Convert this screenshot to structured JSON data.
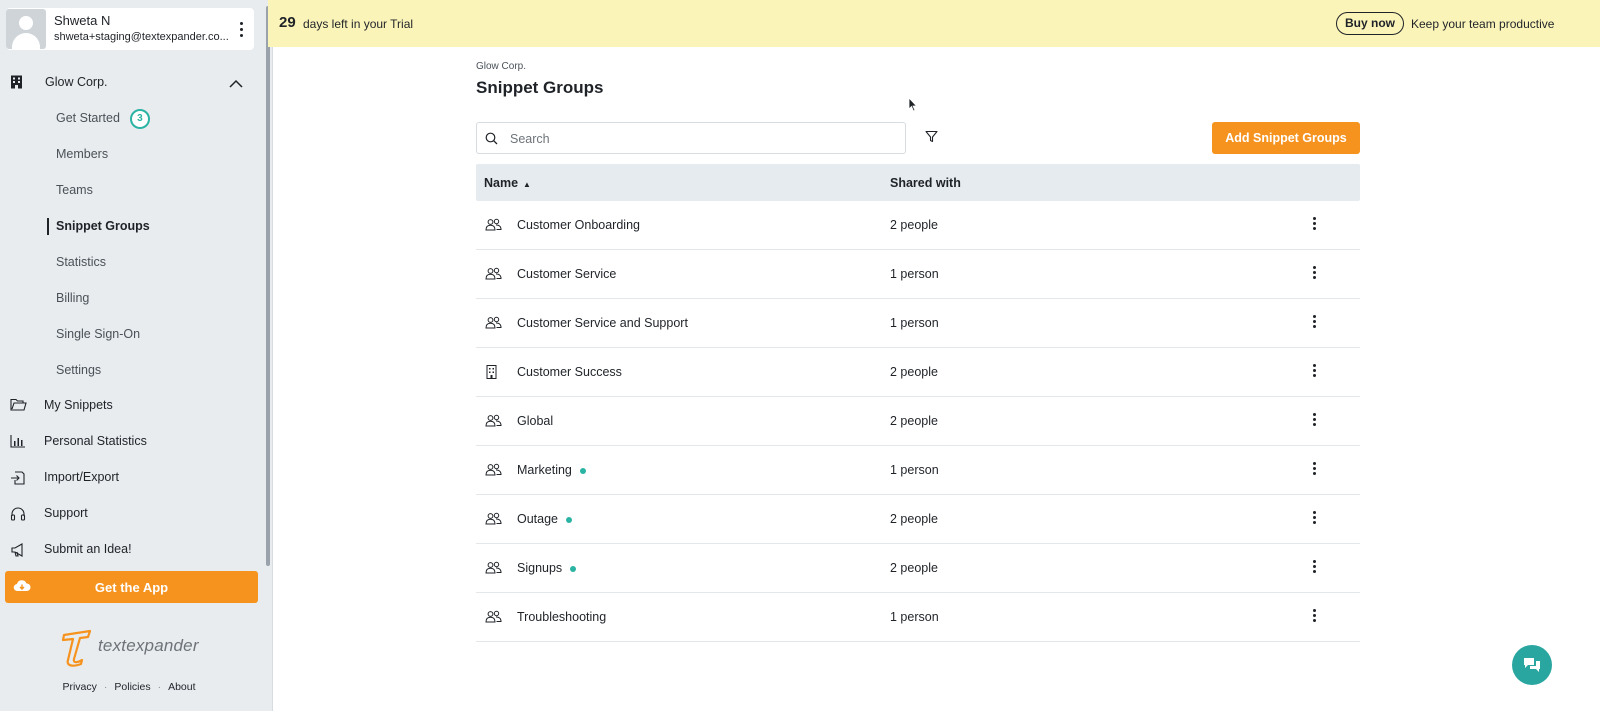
{
  "user": {
    "name": "Shweta N",
    "email": "shweta+staging@textexpander.co..."
  },
  "org": {
    "name": "Glow Corp.",
    "subnav": [
      {
        "label": "Get Started",
        "badge": "3"
      },
      {
        "label": "Members"
      },
      {
        "label": "Teams"
      },
      {
        "label": "Snippet Groups",
        "active": true
      },
      {
        "label": "Statistics"
      },
      {
        "label": "Billing"
      },
      {
        "label": "Single Sign-On"
      },
      {
        "label": "Settings"
      }
    ]
  },
  "mainnav": [
    {
      "label": "My Snippets",
      "icon": "folder-icon"
    },
    {
      "label": "Personal Statistics",
      "icon": "bar-chart-icon"
    },
    {
      "label": "Import/Export",
      "icon": "import-export-icon"
    },
    {
      "label": "Support",
      "icon": "headset-icon"
    },
    {
      "label": "Submit an Idea!",
      "icon": "megaphone-icon"
    }
  ],
  "get_app": {
    "label": "Get the App"
  },
  "logo": {
    "text": "textexpander"
  },
  "footer": {
    "privacy": "Privacy",
    "policies": "Policies",
    "about": "About"
  },
  "banner": {
    "days": "29",
    "days_text": "days left in your Trial",
    "buy_now": "Buy now",
    "tagline": "Keep your team productive"
  },
  "page": {
    "breadcrumb": "Glow Corp.",
    "title": "Snippet Groups",
    "search_placeholder": "Search",
    "add_button": "Add Snippet Groups"
  },
  "table": {
    "col_name": "Name",
    "col_shared": "Shared with",
    "rows": [
      {
        "name": "Customer Onboarding",
        "shared": "2 people",
        "icon": "people-icon",
        "dot": false
      },
      {
        "name": "Customer Service",
        "shared": "1 person",
        "icon": "people-icon",
        "dot": false
      },
      {
        "name": "Customer Service and Support",
        "shared": "1 person",
        "icon": "people-icon",
        "dot": false
      },
      {
        "name": "Customer Success",
        "shared": "2 people",
        "icon": "building-icon",
        "dot": false
      },
      {
        "name": "Global",
        "shared": "2 people",
        "icon": "people-icon",
        "dot": false
      },
      {
        "name": "Marketing",
        "shared": "1 person",
        "icon": "people-icon",
        "dot": true
      },
      {
        "name": "Outage",
        "shared": "2 people",
        "icon": "people-icon",
        "dot": true
      },
      {
        "name": "Signups",
        "shared": "2 people",
        "icon": "people-icon",
        "dot": true
      },
      {
        "name": "Troubleshooting",
        "shared": "1 person",
        "icon": "people-icon",
        "dot": false
      }
    ]
  },
  "colors": {
    "accent_orange": "#f6931e",
    "teal": "#2bb3a3",
    "banner_yellow": "#fbf4b9",
    "sidebar_bg": "#e8ecef"
  }
}
